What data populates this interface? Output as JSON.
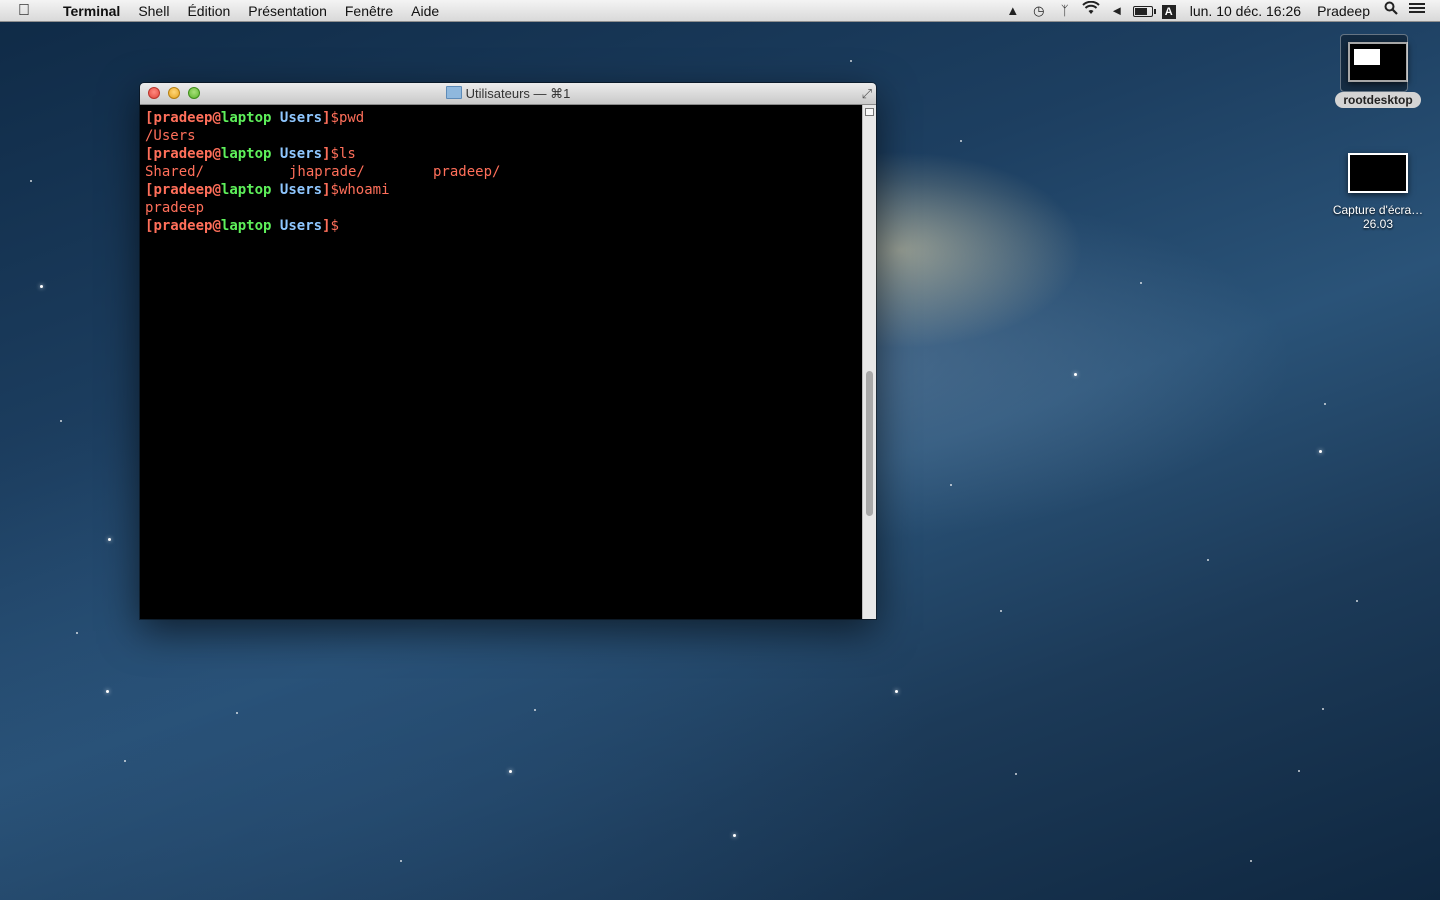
{
  "menubar": {
    "app_name": "Terminal",
    "menus": [
      "Shell",
      "Édition",
      "Présentation",
      "Fenêtre",
      "Aide"
    ],
    "status_icons": [
      "google-drive-icon",
      "time-machine-icon",
      "bluetooth-icon",
      "wifi-icon",
      "volume-icon",
      "battery-icon",
      "input-source-icon"
    ],
    "input_source_letter": "A",
    "clock": "lun. 10 déc. 16:26",
    "user": "Pradeep"
  },
  "window": {
    "title": "Utilisateurs — ⌘1"
  },
  "terminal": {
    "user": "pradeep",
    "host": "laptop",
    "dir": "Users",
    "cmd1": "pwd",
    "out1": "/Users",
    "cmd2": "ls",
    "ls_items": [
      "Shared/",
      "jhaprade/",
      "pradeep/"
    ],
    "cmd3": "whoami",
    "out3": "pradeep"
  },
  "desktop": {
    "icons": [
      {
        "label": "rootdesktop",
        "selected": true
      },
      {
        "label": "Capture d'écra…26.03",
        "selected": false
      }
    ]
  },
  "colors": {
    "prompt_user": "#ff6f5a",
    "prompt_host": "#5ef05a",
    "prompt_dir": "#8fc7ff",
    "terminal_bg": "#000000"
  }
}
